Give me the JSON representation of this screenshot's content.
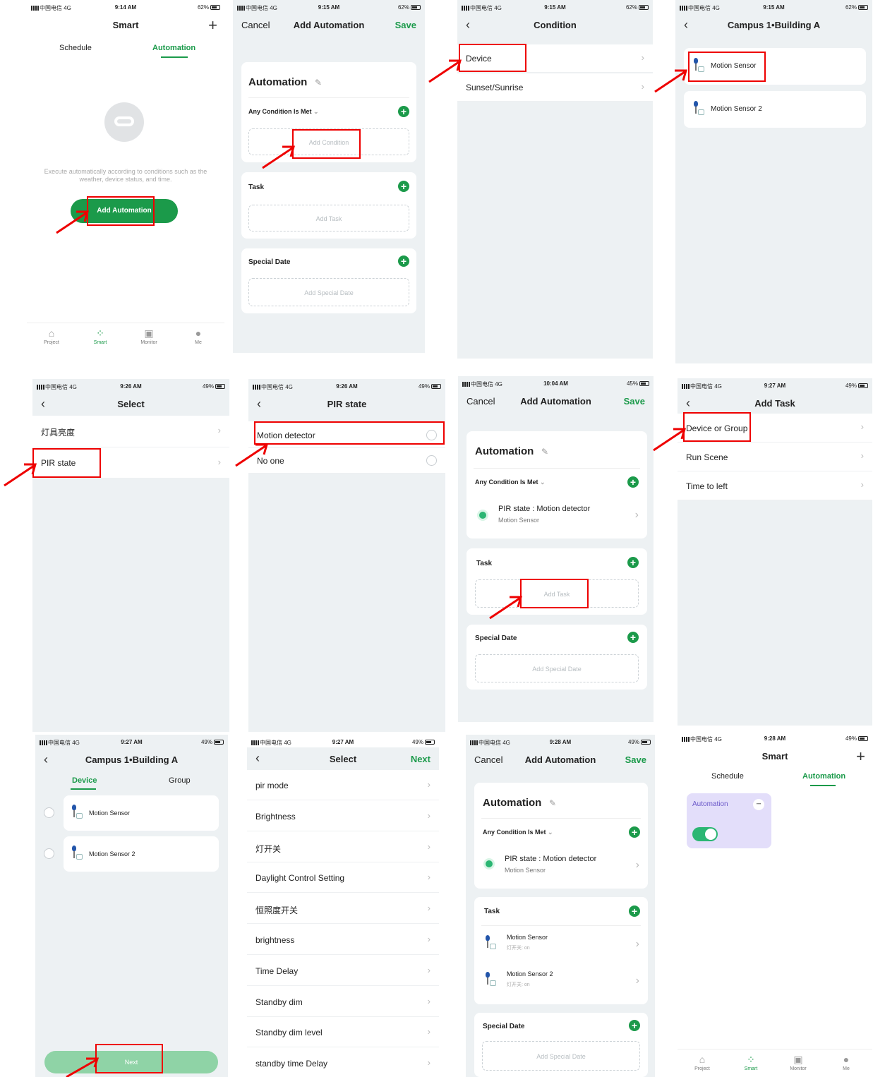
{
  "status": {
    "carrier": "中国电信",
    "net": "4G",
    "battery": [
      "62%",
      "62%",
      "62%",
      "62%",
      "49%",
      "49%",
      "45%",
      "49%",
      "49%",
      "49%",
      "49%",
      "49%"
    ],
    "times": [
      "9:14 AM",
      "9:15 AM",
      "9:15 AM",
      "9:15 AM",
      "9:26 AM",
      "9:26 AM",
      "10:04 AM",
      "9:27 AM",
      "9:27 AM",
      "9:27 AM",
      "9:28 AM",
      "9:28 AM"
    ]
  },
  "s1": {
    "title": "Smart",
    "tab_schedule": "Schedule",
    "tab_automation": "Automation",
    "empty_text": "Execute automatically according to conditions such as the weather, device status, and time.",
    "add_btn": "Add Automation"
  },
  "nav": {
    "project": "Project",
    "smart": "Smart",
    "monitor": "Monitor",
    "me": "Me"
  },
  "add": {
    "cancel": "Cancel",
    "title": "Add Automation",
    "save": "Save",
    "auto_title": "Automation",
    "any_cond": "Any Condition Is Met",
    "add_condition": "Add Condition",
    "task": "Task",
    "add_task": "Add Task",
    "special": "Special Date",
    "add_special": "Add Special Date"
  },
  "s3": {
    "title": "Condition",
    "device": "Device",
    "sunset": "Sunset/Sunrise"
  },
  "s4": {
    "title": "Campus 1•Building A",
    "sensor1": "Motion Sensor",
    "sensor2": "Motion Sensor 2"
  },
  "s5": {
    "title": "Select",
    "opt1": "灯具亮度",
    "opt2": "PIR state"
  },
  "s6": {
    "title": "PIR state",
    "opt1": "Motion detector",
    "opt2": "No one"
  },
  "cond": {
    "line": "PIR state : Motion detector",
    "sub": "Motion Sensor"
  },
  "s8": {
    "title": "Add Task",
    "opt1": "Device or Group",
    "opt2": "Run Scene",
    "opt3": "Time to left"
  },
  "s9": {
    "title": "Campus 1•Building A",
    "tab_device": "Device",
    "tab_group": "Group",
    "next": "Next"
  },
  "s10": {
    "title": "Select",
    "next": "Next",
    "items": [
      "pir mode",
      "Brightness",
      "灯开关",
      "Daylight Control Setting",
      "恒照度开关",
      "brightness",
      "Time Delay",
      "Standby dim",
      "Standby dim level",
      "standby time Delay"
    ]
  },
  "s11": {
    "task1": "Motion Sensor",
    "task1_sub": "灯开关: on",
    "task2": "Motion Sensor 2",
    "task2_sub": "灯开关: on"
  },
  "s12": {
    "card": "Automation",
    "more": "•••"
  }
}
